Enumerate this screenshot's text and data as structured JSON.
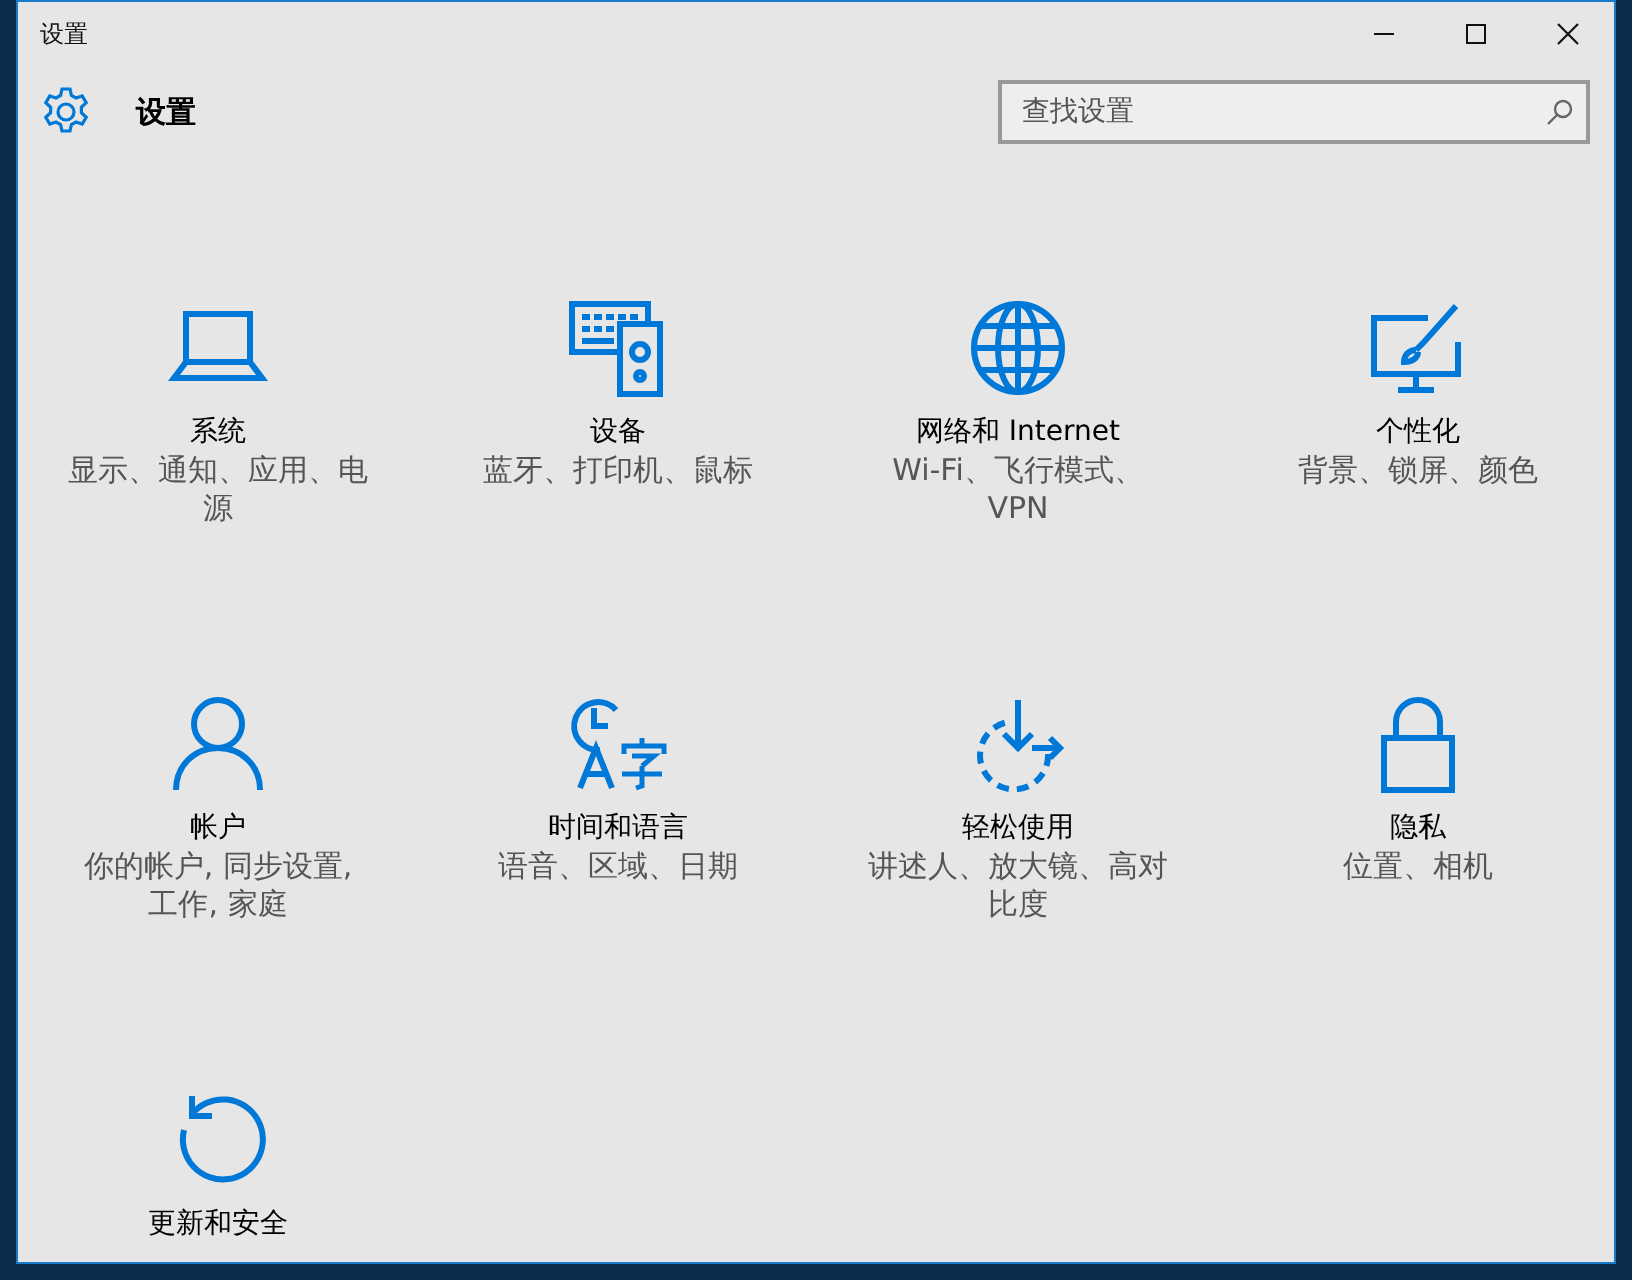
{
  "window": {
    "title": "设置"
  },
  "header": {
    "title": "设置",
    "search": {
      "placeholder": "查找设置"
    }
  },
  "categories": [
    {
      "kind": "laptop",
      "name": "系统",
      "description": "显示、通知、应用、电源"
    },
    {
      "kind": "devices",
      "name": "设备",
      "description": "蓝牙、打印机、鼠标"
    },
    {
      "kind": "network",
      "name": "网络和 Internet",
      "description": "Wi-Fi、飞行模式、VPN"
    },
    {
      "kind": "personalization",
      "name": "个性化",
      "description": "背景、锁屏、颜色"
    },
    {
      "kind": "accounts",
      "name": "帐户",
      "description": "你的帐户, 同步设置, 工作, 家庭"
    },
    {
      "kind": "timelanguage",
      "name": "时间和语言",
      "description": "语音、区域、日期"
    },
    {
      "kind": "ease",
      "name": "轻松使用",
      "description": "讲述人、放大镜、高对比度"
    },
    {
      "kind": "privacy",
      "name": "隐私",
      "description": "位置、相机"
    },
    {
      "kind": "update",
      "name": "更新和安全"
    }
  ]
}
